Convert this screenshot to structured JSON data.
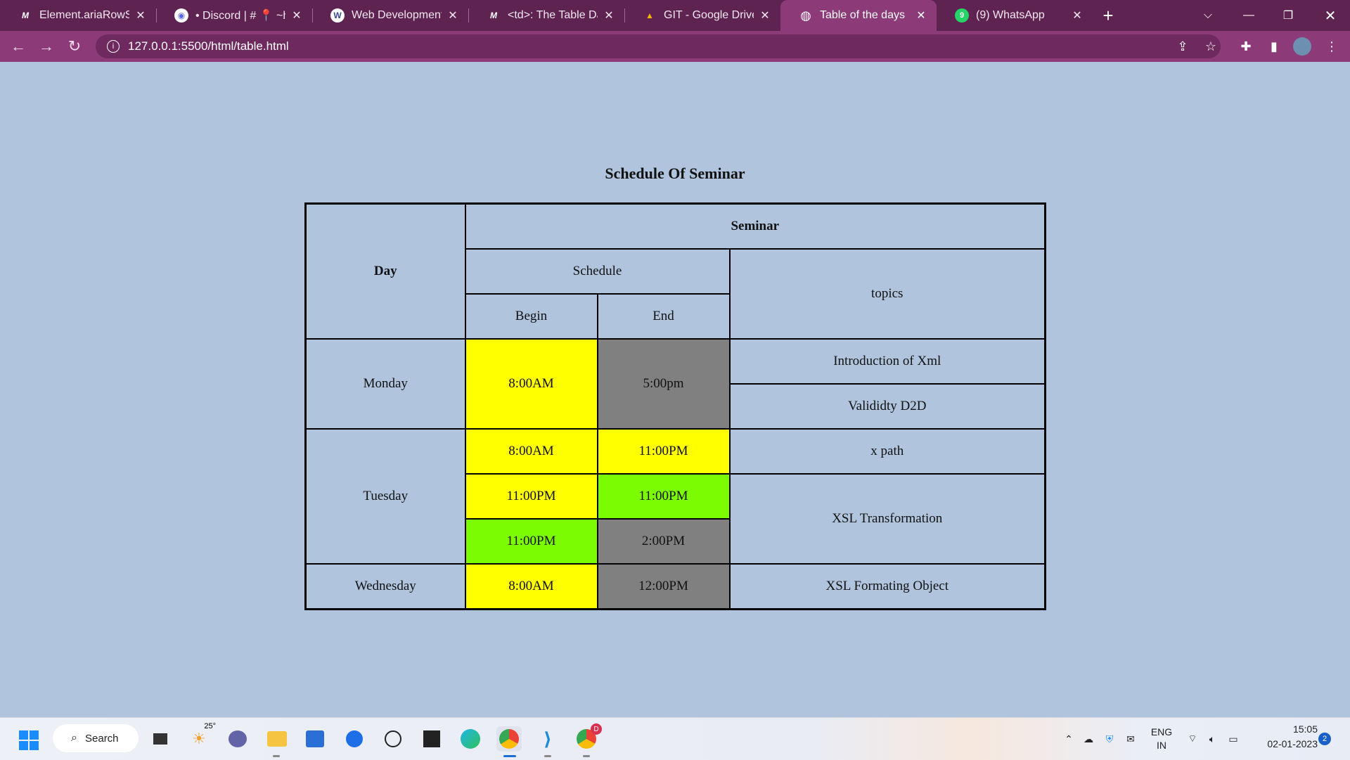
{
  "browser": {
    "tabs": [
      {
        "title": "Element.ariaRowSpan",
        "favicon": "mdn-icon",
        "fav_text": "M",
        "active": false
      },
      {
        "title": "• Discord | # 📍 ~hom",
        "favicon": "discord-icon",
        "fav_text": "◉",
        "active": false
      },
      {
        "title": "Web Development Bo",
        "favicon": "webdev-icon",
        "fav_text": "W",
        "active": false
      },
      {
        "title": "<td>: The Table Data",
        "favicon": "mdn-icon",
        "fav_text": "M",
        "active": false
      },
      {
        "title": "GIT - Google Drive",
        "favicon": "google-drive-icon",
        "fav_text": "▲",
        "active": false
      },
      {
        "title": "Table of the days",
        "favicon": "globe-icon",
        "fav_text": "◍",
        "active": true
      },
      {
        "title": "(9) WhatsApp",
        "favicon": "whatsapp-icon",
        "fav_text": "9",
        "active": false
      }
    ],
    "url": "127.0.0.1:5500/html/table.html",
    "colors": {
      "tabstrip": "#5e2350",
      "toolbar": "#8c3a78",
      "page_bg": "#b0c4de"
    }
  },
  "page": {
    "caption": "Schedule Of Seminar",
    "headers": {
      "day": "Day",
      "seminar": "Seminar",
      "schedule": "Schedule",
      "topics": "topics",
      "begin": "Begin",
      "end": "End"
    },
    "rows": {
      "monday": {
        "day": "Monday",
        "begin": "8:00AM",
        "end": "5:00pm",
        "topic1": "Introduction of Xml",
        "topic2": "Valididty D2D"
      },
      "tuesday": {
        "day": "Tuesday",
        "r1_begin": "8:00AM",
        "r1_end": "11:00PM",
        "r1_topic": "x path",
        "r2_begin": "11:00PM",
        "r2_end": "11:00PM",
        "r2_topic": "XSL Transformation",
        "r3_begin": "11:00PM",
        "r3_end": "2:00PM"
      },
      "wednesday": {
        "day": "Wednesday",
        "begin": "8:00AM",
        "end": "12:00PM",
        "topic": "XSL Formating Object"
      }
    },
    "cell_colors": {
      "yellow": "#ffff00",
      "grey": "#808080",
      "green": "#7cfc00"
    }
  },
  "taskbar": {
    "search_label": "Search",
    "weather": "25°",
    "language": "ENG",
    "region": "IN",
    "time": "15:05",
    "date": "02-01-2023",
    "notification_count": "2",
    "avatar_badge": "D"
  }
}
